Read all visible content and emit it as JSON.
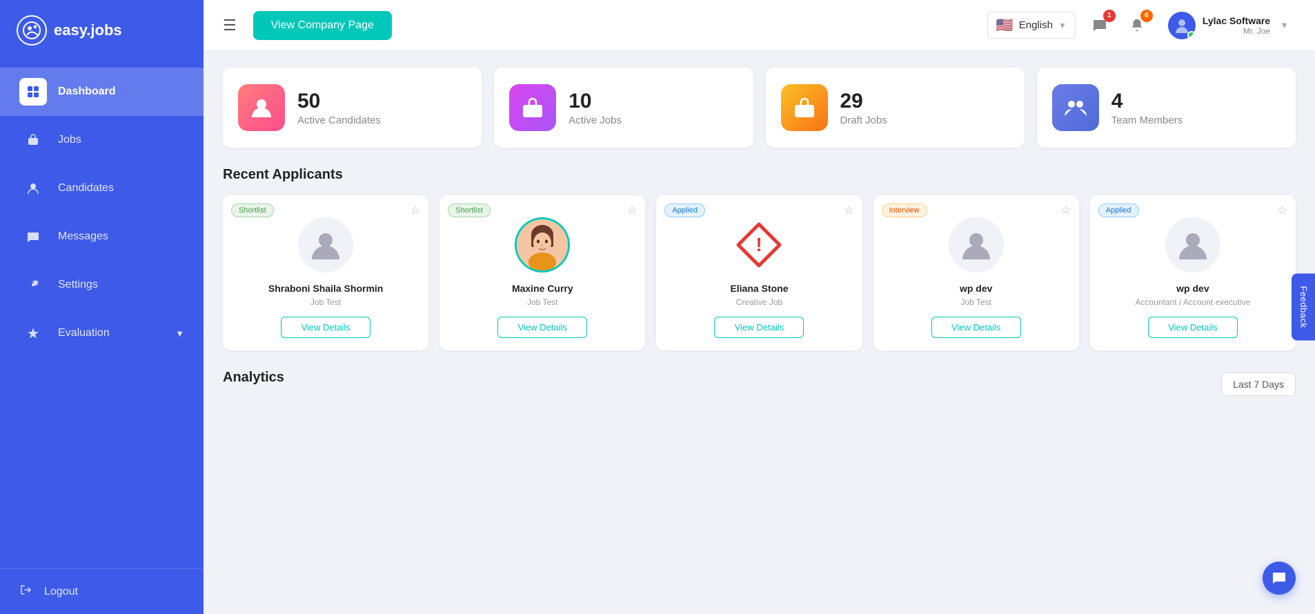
{
  "sidebar": {
    "logo_icon": "Q",
    "logo_text": "easy.jobs",
    "nav_items": [
      {
        "id": "dashboard",
        "label": "Dashboard",
        "icon": "🏠",
        "active": true
      },
      {
        "id": "jobs",
        "label": "Jobs",
        "icon": "💼",
        "active": false
      },
      {
        "id": "candidates",
        "label": "Candidates",
        "icon": "👤",
        "active": false
      },
      {
        "id": "messages",
        "label": "Messages",
        "icon": "💬",
        "active": false
      },
      {
        "id": "settings",
        "label": "Settings",
        "icon": "⚙️",
        "active": false
      },
      {
        "id": "evaluation",
        "label": "Evaluation",
        "icon": "🎓",
        "active": false,
        "has_chevron": true
      }
    ],
    "logout_label": "Logout"
  },
  "header": {
    "view_company_label": "View Company Page",
    "language": "English",
    "chat_badge": "1",
    "notification_badge": "6",
    "company_name": "Lylac Software",
    "user_name": "Mr. Joe"
  },
  "stats": [
    {
      "id": "active-candidates",
      "number": "50",
      "label": "Active Candidates",
      "icon_type": "pink",
      "icon": "person"
    },
    {
      "id": "active-jobs",
      "number": "10",
      "label": "Active Jobs",
      "icon_type": "magenta",
      "icon": "briefcase"
    },
    {
      "id": "draft-jobs",
      "number": "29",
      "label": "Draft Jobs",
      "icon_type": "orange",
      "icon": "briefcase"
    },
    {
      "id": "team-members",
      "number": "4",
      "label": "Team Members",
      "icon_type": "blue",
      "icon": "team"
    }
  ],
  "recent_applicants": {
    "title": "Recent Applicants",
    "applicants": [
      {
        "id": "a1",
        "name": "Shraboni Shaila Shormin",
        "job": "Job Test",
        "status": "Shortlist",
        "status_type": "shortlist",
        "has_avatar": false
      },
      {
        "id": "a2",
        "name": "Maxine Curry",
        "job": "Job Test",
        "status": "Shortlist",
        "status_type": "shortlist",
        "has_avatar": true
      },
      {
        "id": "a3",
        "name": "Eliana Stone",
        "job": "Creative Job",
        "status": "Applied",
        "status_type": "applied",
        "has_avatar": false,
        "error": true
      },
      {
        "id": "a4",
        "name": "wp dev",
        "job": "Job Test",
        "status": "Interview",
        "status_type": "interview",
        "has_avatar": false
      },
      {
        "id": "a5",
        "name": "wp dev",
        "job": "Accountant / Account executive",
        "status": "Applied",
        "status_type": "applied",
        "has_avatar": false
      }
    ],
    "view_details_label": "View Details"
  },
  "analytics": {
    "title": "Analytics",
    "period_label": "Last 7 Days"
  },
  "feedback_label": "Feedback",
  "chat_icon": "💬"
}
